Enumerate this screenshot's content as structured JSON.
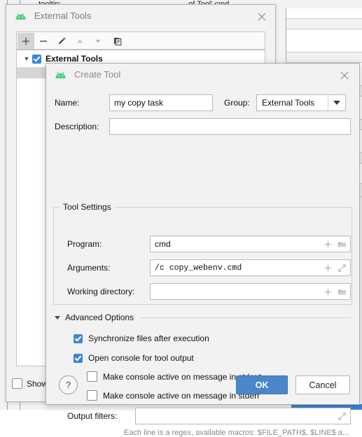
{
  "background": {
    "label_left": "tooltip:",
    "label_mid": "...of Tool' cmd",
    "accent_blue": "#3c86d4"
  },
  "external_tools_window": {
    "title": "External Tools",
    "app_icon": "android-icon",
    "close_icon": "close-icon",
    "toolbar": [
      {
        "name": "add-button",
        "icon": "plus-icon",
        "enabled": true,
        "active": true
      },
      {
        "name": "remove-button",
        "icon": "minus-icon",
        "enabled": true,
        "active": false
      },
      {
        "name": "edit-button",
        "icon": "pencil-icon",
        "enabled": true,
        "active": false
      },
      {
        "name": "move-up-button",
        "icon": "arrow-up-icon",
        "enabled": false,
        "active": false
      },
      {
        "name": "move-down-button",
        "icon": "arrow-down-icon",
        "enabled": false,
        "active": false
      },
      {
        "name": "copy-button",
        "icon": "copy-icon",
        "enabled": true,
        "active": false
      }
    ],
    "tree": {
      "root_label": "External Tools",
      "root_checked": true,
      "expanded": true
    },
    "show_all_label": "Show t",
    "show_all_checked": false
  },
  "create_tool_dialog": {
    "title": "Create Tool",
    "app_icon": "android-icon",
    "close_icon": "close-icon",
    "name": {
      "label": "Name:",
      "value": "my copy task",
      "placeholder": ""
    },
    "group": {
      "label": "Group:",
      "value": "External Tools",
      "options": [
        "External Tools"
      ]
    },
    "description": {
      "label": "Description:",
      "value": "",
      "placeholder": ""
    },
    "tool_settings": {
      "legend": "Tool Settings",
      "program": {
        "label": "Program:",
        "value": "cmd",
        "icons": [
          "plus-icon",
          "folder-icon"
        ]
      },
      "arguments": {
        "label": "Arguments:",
        "value": "/c copy_webenv.cmd",
        "icons": [
          "plus-icon",
          "expand-icon"
        ]
      },
      "working_directory": {
        "label": "Working directory:",
        "value": "",
        "icons": [
          "plus-icon",
          "folder-icon"
        ]
      }
    },
    "advanced_options": {
      "label": "Advanced Options",
      "expanded": true,
      "checkboxes": [
        {
          "label": "Synchronize files after execution",
          "checked": true,
          "indent": 0
        },
        {
          "label": "Open console for tool output",
          "checked": true,
          "indent": 0
        },
        {
          "label": "Make console active on message in stdout",
          "checked": false,
          "indent": 1
        },
        {
          "label": "Make console active on message in stderr",
          "checked": false,
          "indent": 1
        }
      ]
    },
    "output_filters": {
      "label": "Output filters:",
      "value": "",
      "icons": [
        "expand-icon"
      ],
      "hint": "Each line is a regex, available macros: $FILE_PATH$, $LINE$ a..."
    },
    "buttons": {
      "help": "?",
      "ok": "OK",
      "cancel": "Cancel"
    },
    "colors": {
      "ok_background": "#4a86c8",
      "checkbox_blue": "#3c86d4"
    }
  }
}
